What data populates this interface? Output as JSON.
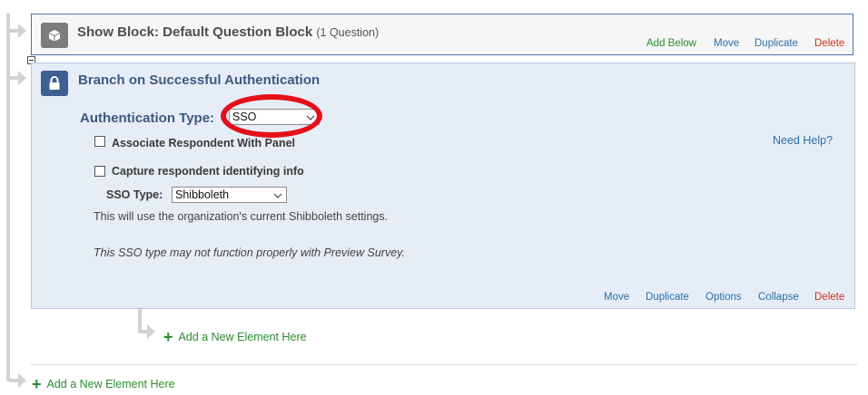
{
  "show_block": {
    "title": "Show Block: Default Question Block",
    "count": "(1 Question)",
    "actions": {
      "add_below": "Add Below",
      "move": "Move",
      "duplicate": "Duplicate",
      "delete": "Delete"
    }
  },
  "branch_block": {
    "title": "Branch on Successful Authentication",
    "auth_type_label": "Authentication Type:",
    "auth_type_value": "SSO",
    "need_help": "Need Help?",
    "option_associate": "Associate Respondent With Panel",
    "option_capture": "Capture respondent identifying info",
    "sso_type_label": "SSO Type:",
    "sso_type_value": "Shibboleth",
    "info": "This will use the organization's current Shibboleth settings.",
    "warning": "This SSO type may not function properly with Preview Survey.",
    "actions": {
      "move": "Move",
      "duplicate": "Duplicate",
      "options": "Options",
      "collapse": "Collapse",
      "delete": "Delete"
    }
  },
  "add_element_inner": "Add a New Element Here",
  "add_element_outer": "Add a New Element Here",
  "colors": {
    "action_blue": "#2a6fa8",
    "delete_red": "#c8361d",
    "add_green": "#2e8b2e",
    "branch_title": "#3d5a82",
    "highlight_ellipse": "#e3101b"
  }
}
